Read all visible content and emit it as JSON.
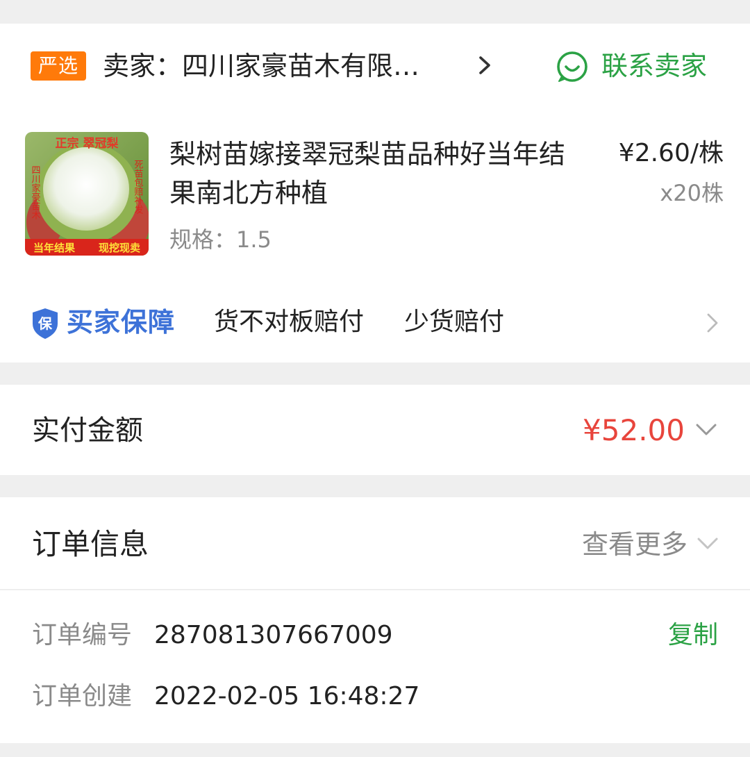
{
  "colors": {
    "accent_green": "#2ba245",
    "price_red": "#e8453c",
    "guarantee_blue": "#3d72d8",
    "badge_orange": "#ff7a0a"
  },
  "seller": {
    "badge": "严选",
    "name": "卖家：四川家豪苗木有限…",
    "contact_label": "联系卖家"
  },
  "product": {
    "title": "梨树苗嫁接翠冠梨苗品种好当年结果南北方种植",
    "spec": "规格：1.5",
    "price": "¥2.60/株",
    "quantity": "x20株",
    "thumbnail_text": {
      "top": "正宗 翠冠梨",
      "left": "四川家豪苗木",
      "right": "死苗包赔补发",
      "bottom_left": "当年结果",
      "bottom_right": "现挖现卖"
    }
  },
  "guarantee": {
    "label": "买家保障",
    "shield_char": "保",
    "items": [
      "货不对板赔付",
      "少货赔付"
    ]
  },
  "payment": {
    "label": "实付金额",
    "amount": "¥52.00"
  },
  "order_info": {
    "title": "订单信息",
    "more_label": "查看更多",
    "rows": [
      {
        "label": "订单编号",
        "value": "287081307667009",
        "action": "复制"
      },
      {
        "label": "订单创建",
        "value": "2022-02-05 16:48:27"
      }
    ]
  },
  "icons": {
    "seller_arrow": "chevron-right-icon",
    "contact": "chat-smile-icon",
    "guarantee": "shield-icon",
    "guarantee_arrow": "chevron-right-icon",
    "payment_expand": "chevron-down-icon",
    "order_more": "chevron-down-icon"
  }
}
